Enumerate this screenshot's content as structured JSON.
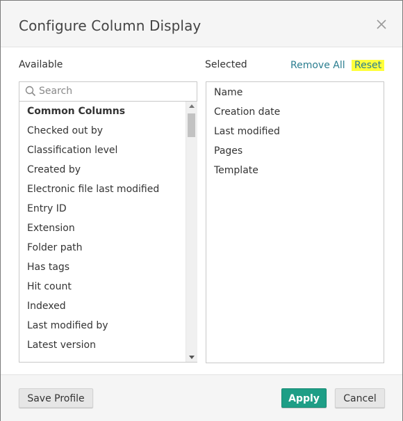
{
  "dialog": {
    "title": "Configure Column Display"
  },
  "available": {
    "label": "Available",
    "search_placeholder": "Search",
    "items": [
      {
        "label": "Common Columns",
        "group": true
      },
      {
        "label": "Checked out by"
      },
      {
        "label": "Classification level"
      },
      {
        "label": "Created by"
      },
      {
        "label": "Electronic file last modified"
      },
      {
        "label": "Entry ID"
      },
      {
        "label": "Extension"
      },
      {
        "label": "Folder path"
      },
      {
        "label": "Has tags"
      },
      {
        "label": "Hit count"
      },
      {
        "label": "Indexed"
      },
      {
        "label": "Last modified by"
      },
      {
        "label": "Latest version"
      }
    ]
  },
  "selected": {
    "label": "Selected",
    "remove_all_label": "Remove All",
    "reset_label": "Reset",
    "items": [
      "Name",
      "Creation date",
      "Last modified",
      "Pages",
      "Template"
    ]
  },
  "footer": {
    "save_profile_label": "Save Profile",
    "apply_label": "Apply",
    "cancel_label": "Cancel"
  },
  "colors": {
    "accent": "#1e9e86",
    "link": "#2a7d8f",
    "highlight": "#ffff3a"
  }
}
